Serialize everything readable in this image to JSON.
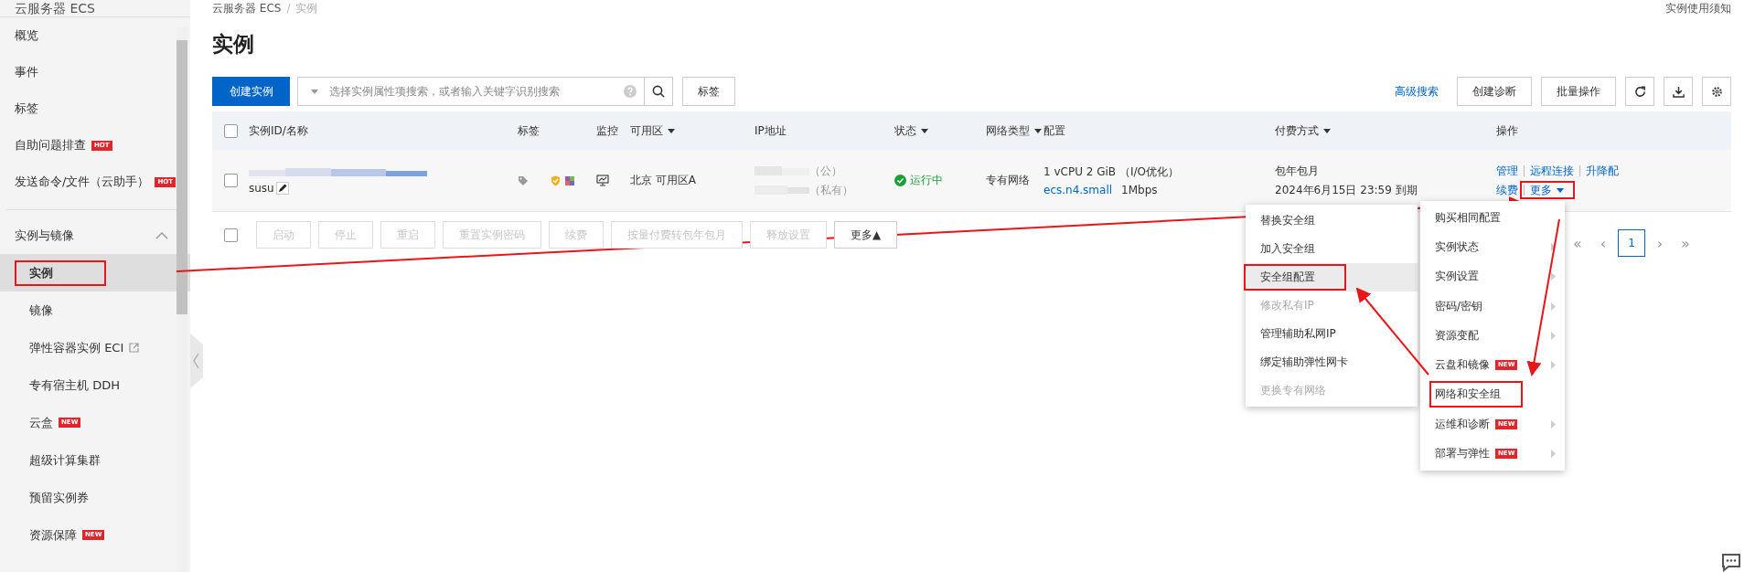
{
  "sidebar": {
    "title": "云服务器 ECS",
    "items": [
      {
        "label": "概览",
        "selected": false
      },
      {
        "label": "事件",
        "selected": false
      },
      {
        "label": "标签",
        "selected": false
      },
      {
        "label": "自助问题排查",
        "badge": "HOT",
        "selected": false
      },
      {
        "label": "发送命令/文件（云助手）",
        "badge": "HOT",
        "selected": false
      }
    ],
    "group": {
      "label": "实例与镜像",
      "expanded": true,
      "children": [
        {
          "label": "实例",
          "selected": true,
          "annotated": true
        },
        {
          "label": "镜像",
          "selected": false
        },
        {
          "label": "弹性容器实例 ECI",
          "external": true,
          "selected": false
        },
        {
          "label": "专有宿主机 DDH",
          "selected": false
        },
        {
          "label": "云盒",
          "badge": "NEW",
          "selected": false
        },
        {
          "label": "超级计算集群",
          "selected": false
        },
        {
          "label": "预留实例券",
          "selected": false
        },
        {
          "label": "资源保障",
          "badge": "NEW",
          "selected": false
        }
      ]
    }
  },
  "breadcrumb": [
    "云服务器 ECS",
    "实例"
  ],
  "breadcrumb_separator": "/",
  "help_link": "实例使用须知",
  "page_title": "实例",
  "toolbar": {
    "create_button": "创建实例",
    "search": {
      "placeholder": "选择实例属性项搜索，或者输入关键字识别搜索"
    },
    "tag_button": "标签",
    "advanced_search": "高级搜索",
    "buttons": [
      "创建诊断",
      "批量操作"
    ]
  },
  "table": {
    "select_all_checked": false,
    "columns": [
      {
        "label": "实例ID/名称",
        "sortable": false
      },
      {
        "label": "标签",
        "sortable": false
      },
      {
        "label": "监控",
        "sortable": false
      },
      {
        "label": "可用区",
        "sortable": true
      },
      {
        "label": "IP地址",
        "sortable": false
      },
      {
        "label": "状态",
        "sortable": true
      },
      {
        "label": "网络类型",
        "sortable": true
      },
      {
        "label": "配置",
        "sortable": false
      },
      {
        "label": "付费方式",
        "sortable": true
      },
      {
        "label": "操作",
        "sortable": false
      }
    ],
    "rows": [
      {
        "checked": false,
        "name": "susu",
        "zone": "北京 可用区A",
        "ip_public": "（公）",
        "ip_private": "（私有）",
        "status": "运行中",
        "network": "专有网络",
        "config": "1 vCPU 2 GiB （I/O优化）",
        "instance_type": "ecs.n4.small",
        "bandwidth": "1Mbps",
        "billing": "包年包月",
        "expires": "2024年6月15日 23:59 到期",
        "actions": [
          "管理",
          "远程连接",
          "升降配",
          "续费"
        ],
        "more": "更多",
        "more_annotated": true
      }
    ]
  },
  "batch_select_checked": false,
  "batch_actions": [
    {
      "label": "启动",
      "disabled": true
    },
    {
      "label": "停止",
      "disabled": true
    },
    {
      "label": "重启",
      "disabled": true
    },
    {
      "label": "重置实例密码",
      "disabled": true
    },
    {
      "label": "续费",
      "disabled": true
    },
    {
      "label": "按量付费转包年包月",
      "disabled": true
    },
    {
      "label": "释放设置",
      "disabled": true
    },
    {
      "label": "更多▲",
      "disabled": false
    }
  ],
  "pagination": {
    "first": "«",
    "prev": "‹",
    "pages": [
      {
        "label": "1",
        "selected": true
      }
    ],
    "next": "›",
    "last": "»"
  },
  "more_menu": [
    {
      "label": "购买相同配置",
      "submenu": false,
      "annotated": false
    },
    {
      "label": "实例状态",
      "submenu": true,
      "annotated": false
    },
    {
      "label": "实例设置",
      "submenu": true,
      "annotated": false
    },
    {
      "label": "密码/密钥",
      "submenu": true,
      "annotated": false
    },
    {
      "label": "资源变配",
      "submenu": true,
      "annotated": false
    },
    {
      "label": "云盘和镜像",
      "badge": "NEW",
      "submenu": true,
      "annotated": false
    },
    {
      "label": "网络和安全组",
      "submenu": false,
      "annotated": true
    },
    {
      "label": "运维和诊断",
      "badge": "NEW",
      "submenu": true,
      "annotated": false
    },
    {
      "label": "部署与弹性",
      "badge": "NEW",
      "submenu": true,
      "annotated": false
    }
  ],
  "submenu": [
    {
      "label": "替换安全组",
      "disabled": false,
      "selected": false,
      "annotated": false
    },
    {
      "label": "加入安全组",
      "disabled": false,
      "selected": false,
      "annotated": false
    },
    {
      "label": "安全组配置",
      "disabled": false,
      "selected": true,
      "annotated": true
    },
    {
      "label": "修改私有IP",
      "disabled": true,
      "selected": false,
      "annotated": false
    },
    {
      "label": "管理辅助私网IP",
      "disabled": false,
      "selected": false,
      "annotated": false
    },
    {
      "label": "绑定辅助弹性网卡",
      "disabled": false,
      "selected": false,
      "annotated": false
    },
    {
      "label": "更换专有网络",
      "disabled": true,
      "selected": false,
      "annotated": false
    }
  ]
}
